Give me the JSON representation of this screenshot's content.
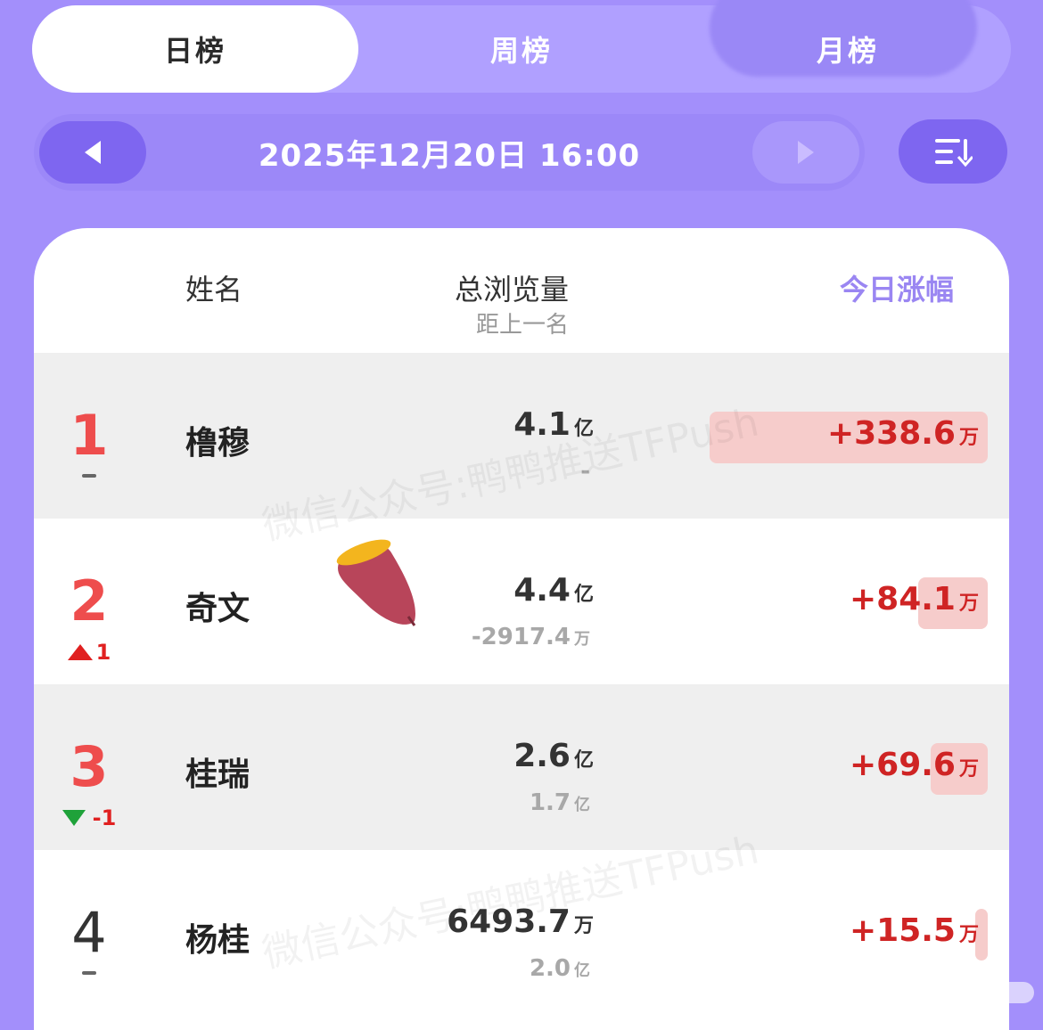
{
  "tabs": [
    {
      "label": "日榜",
      "active": true
    },
    {
      "label": "周榜",
      "active": false
    },
    {
      "label": "月榜",
      "active": false
    }
  ],
  "date_bar": {
    "datetime": "2025年12月20日 16:00"
  },
  "table_header": {
    "name": "姓名",
    "views": "总浏览量",
    "gap": "距上一名",
    "gain": "今日涨幅"
  },
  "rows": [
    {
      "rank": "1",
      "change": "-",
      "name": "橹穆",
      "views": "4.1",
      "views_unit": "亿",
      "gap": "-",
      "gap_unit": "",
      "gain": "+338.6",
      "gain_unit": "万"
    },
    {
      "rank": "2",
      "change": "1",
      "change_dir": "up",
      "name": "奇文",
      "views": "4.4",
      "views_unit": "亿",
      "gap": "-2917.4",
      "gap_unit": "万",
      "gain": "+84.1",
      "gain_unit": "万"
    },
    {
      "rank": "3",
      "change": "-1",
      "change_dir": "down",
      "name": "桂瑞",
      "views": "2.6",
      "views_unit": "亿",
      "gap": "1.7",
      "gap_unit": "亿",
      "gain": "+69.6",
      "gain_unit": "万"
    },
    {
      "rank": "4",
      "change": "-",
      "name": "杨桂",
      "views": "6493.7",
      "views_unit": "万",
      "gap": "2.0",
      "gap_unit": "亿",
      "gain": "+15.5",
      "gain_unit": "万"
    }
  ],
  "watermark": "微信公众号:鸭鸭推送TFPush",
  "colors": {
    "accent": "#7e66f0",
    "rank_red": "#ee4d4d",
    "gain_red": "#cf2424",
    "gain_bar": "#f6cccb",
    "up": "#e02020",
    "down": "#1fa23a"
  }
}
